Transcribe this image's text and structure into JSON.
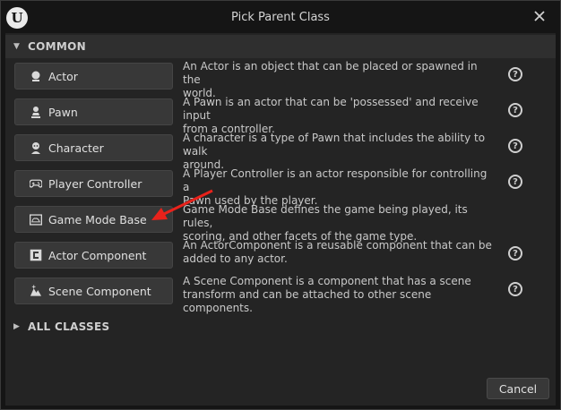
{
  "window": {
    "title": "Pick Parent Class",
    "logo_letter": "U"
  },
  "sections": {
    "common": "COMMON",
    "all_classes": "ALL CLASSES"
  },
  "classes": [
    {
      "label": "Actor",
      "icon": "actor-icon",
      "desc_line1": "An Actor is an object that can be placed or spawned in the",
      "desc_line2": "world."
    },
    {
      "label": "Pawn",
      "icon": "pawn-icon",
      "desc_line1": "A Pawn is an actor that can be 'possessed' and receive input",
      "desc_line2": "from a controller."
    },
    {
      "label": "Character",
      "icon": "character-icon",
      "desc_line1": "A character is a type of Pawn that includes the ability to walk",
      "desc_line2": "around."
    },
    {
      "label": "Player Controller",
      "icon": "gamepad-icon",
      "desc_line1": "A Player Controller is an actor responsible for controlling a",
      "desc_line2": "Pawn used by the player."
    },
    {
      "label": "Game Mode Base",
      "icon": "game-mode-icon",
      "desc_line1": "Game Mode Base defines the game being played, its rules,",
      "desc_line2": "scoring, and other facets of the game type."
    },
    {
      "label": "Actor Component",
      "icon": "actor-component-icon",
      "desc_line1": "An ActorComponent is a reusable component that can be",
      "desc_line2": "added to any actor."
    },
    {
      "label": "Scene Component",
      "icon": "scene-component-icon",
      "desc_line1": "A Scene Component is a component that has a scene",
      "desc_line2": "transform and can be attached to other scene components."
    }
  ],
  "help_glyph": "?",
  "footer": {
    "cancel_label": "Cancel"
  },
  "colors": {
    "background": "#242424",
    "button": "#383838",
    "arrow": "#e8221b"
  }
}
